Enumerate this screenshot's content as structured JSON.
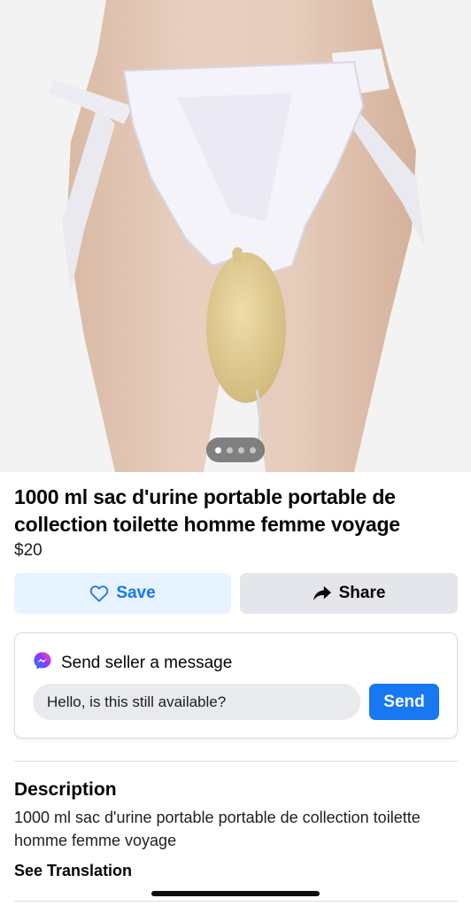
{
  "listing": {
    "title": "1000 ml sac d'urine portable portable de collection toilette homme femme voyage",
    "price": "$20",
    "photo_count": 4,
    "active_photo_index": 0
  },
  "actions": {
    "save_label": "Save",
    "share_label": "Share"
  },
  "message": {
    "heading": "Send seller a message",
    "input_value": "Hello, is this still available?",
    "send_label": "Send"
  },
  "description": {
    "heading": "Description",
    "body": "1000 ml sac d'urine portable portable de collection toilette homme femme voyage",
    "see_translation": "See Translation"
  },
  "colors": {
    "accent": "#1877f2",
    "save_bg": "#e7f3ff",
    "share_bg": "#e4e6eb"
  },
  "icons": [
    "heart-icon",
    "share-arrow-icon",
    "messenger-icon"
  ]
}
